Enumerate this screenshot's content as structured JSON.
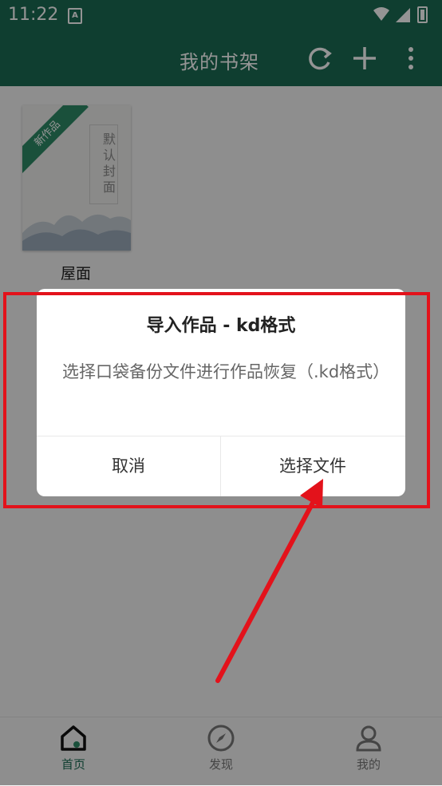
{
  "status_bar": {
    "time": "11:22",
    "a_icon": "A"
  },
  "appbar": {
    "title": "我的书架"
  },
  "book": {
    "cover_badge": "新作品",
    "cover_text": "默认封面",
    "name": "屋面",
    "subtitle": "…"
  },
  "dialog": {
    "title": "导入作品 - kd格式",
    "message": "选择口袋备份文件进行作品恢复（.kd格式）",
    "cancel_label": "取消",
    "confirm_label": "选择文件"
  },
  "bottom_nav": {
    "items": [
      {
        "label": "首页"
      },
      {
        "label": "发现"
      },
      {
        "label": "我的"
      }
    ]
  },
  "colors": {
    "brand": "#1b6b53",
    "annotation": "#e3121b"
  }
}
